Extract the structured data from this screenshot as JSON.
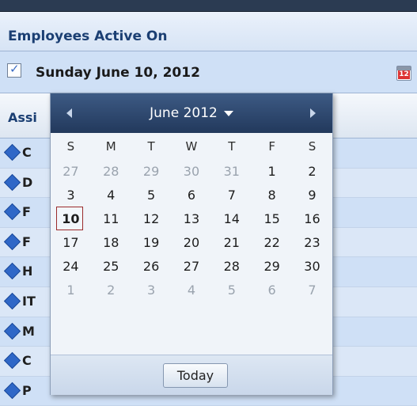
{
  "section": {
    "title": "Employees Active On"
  },
  "date_row": {
    "checked": "✓",
    "date": "Sunday June 10, 2012",
    "calendar_icon_num": "12"
  },
  "column_header": {
    "label": "Assi"
  },
  "rows": [
    "C",
    "D",
    "F",
    "F",
    "H",
    "IT",
    "M",
    "C",
    "P"
  ],
  "calendar": {
    "month_label": "June 2012",
    "day_names": [
      "S",
      "M",
      "T",
      "W",
      "T",
      "F",
      "S"
    ],
    "weeks": [
      [
        "27",
        "28",
        "29",
        "30",
        "31",
        "1",
        "2"
      ],
      [
        "3",
        "4",
        "5",
        "6",
        "7",
        "8",
        "9"
      ],
      [
        "10",
        "11",
        "12",
        "13",
        "14",
        "15",
        "16"
      ],
      [
        "17",
        "18",
        "19",
        "20",
        "21",
        "22",
        "23"
      ],
      [
        "24",
        "25",
        "26",
        "27",
        "28",
        "29",
        "30"
      ],
      [
        "1",
        "2",
        "3",
        "4",
        "5",
        "6",
        "7"
      ]
    ],
    "other_month": [
      [
        true,
        true,
        true,
        true,
        true,
        false,
        false
      ],
      [
        false,
        false,
        false,
        false,
        false,
        false,
        false
      ],
      [
        false,
        false,
        false,
        false,
        false,
        false,
        false
      ],
      [
        false,
        false,
        false,
        false,
        false,
        false,
        false
      ],
      [
        false,
        false,
        false,
        false,
        false,
        false,
        false
      ],
      [
        true,
        true,
        true,
        true,
        true,
        true,
        true
      ]
    ],
    "selected": "10",
    "today_label": "Today"
  },
  "colors": {
    "accent": "#2f67c7",
    "header_dark": "#22395c",
    "selected_border": "#9b2b2b"
  }
}
